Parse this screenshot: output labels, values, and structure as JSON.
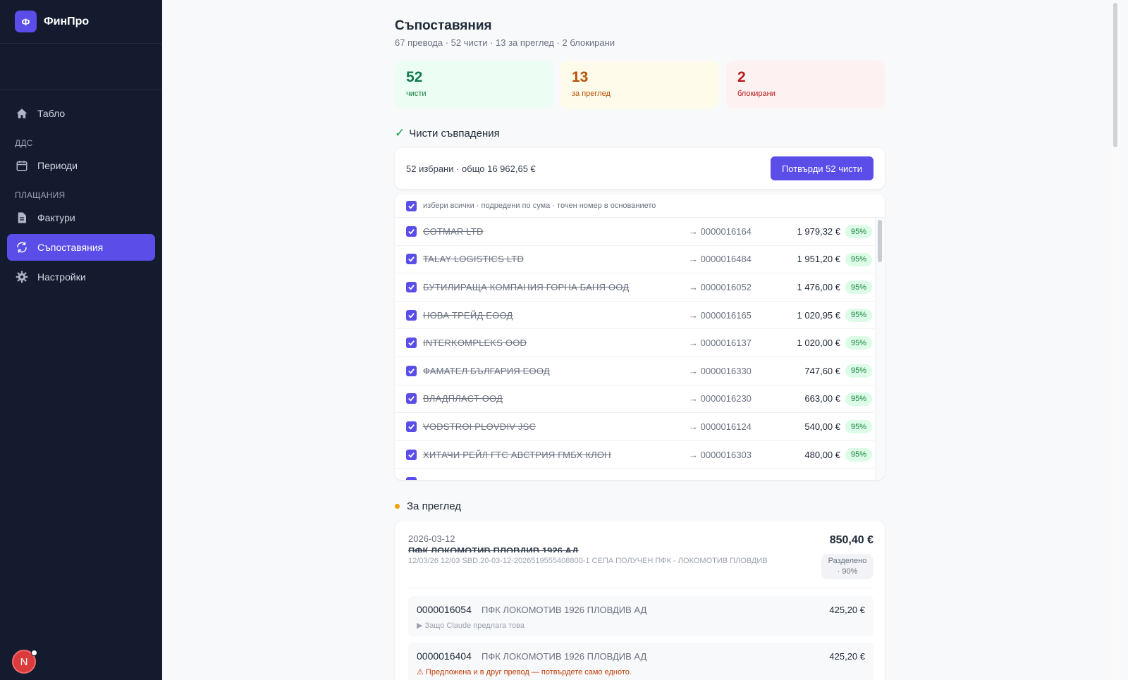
{
  "sidebar": {
    "brand_initial": "Ф",
    "brand_name": "ФинПро",
    "items": {
      "dashboard": "Табло",
      "section_vat": "ДДС",
      "periods": "Периоди",
      "section_payments": "ПЛАЩАНИЯ",
      "invoices": "Фактури",
      "matches": "Съпоставяния",
      "settings": "Настройки"
    },
    "avatar_initial": "N"
  },
  "header": {
    "title": "Съпоставяния",
    "subtitle": "67 превода · 52 чисти · 13 за преглед · 2 блокирани"
  },
  "stats": [
    {
      "value": "52",
      "label": "чисти"
    },
    {
      "value": "13",
      "label": "за преглед"
    },
    {
      "value": "2",
      "label": "блокирани"
    }
  ],
  "clean": {
    "heading": "Чисти съвпадения",
    "selected_text": "52 избрани · общо 16 962,65 €",
    "confirm_label": "Потвърди 52 чисти",
    "list_header": "избери всички · подредени по сума · точен номер в основанието",
    "rows": [
      {
        "name": "COTMAR LTD",
        "ref": "→ 0000016164",
        "amount": "1 979,32 €",
        "score": "95%"
      },
      {
        "name": "TALAY LOGISTICS LTD",
        "ref": "→ 0000016484",
        "amount": "1 951,20 €",
        "score": "95%"
      },
      {
        "name": "БУТИЛИРАЩА КОМПАНИЯ ГОРНА БАНЯ ООД",
        "ref": "→ 0000016052",
        "amount": "1 476,00 €",
        "score": "95%"
      },
      {
        "name": "НОВА ТРЕЙД ЕООД",
        "ref": "→ 0000016165",
        "amount": "1 020,95 €",
        "score": "95%"
      },
      {
        "name": "INTERKOMPLEKS OOD",
        "ref": "→ 0000016137",
        "amount": "1 020,00 €",
        "score": "95%"
      },
      {
        "name": "ФАМАТЕЛ БЪЛГАРИЯ ЕООД",
        "ref": "→ 0000016330",
        "amount": "747,60 €",
        "score": "95%"
      },
      {
        "name": "ВЛАДПЛАСТ ООД",
        "ref": "→ 0000016230",
        "amount": "663,00 €",
        "score": "95%"
      },
      {
        "name": "VODSTROI PLOVDIV JSC",
        "ref": "→ 0000016124",
        "amount": "540,00 €",
        "score": "95%"
      },
      {
        "name": "ХИТАЧИ РЕЙЛ ГТС АВСТРИЯ ГМБХ КЛОН",
        "ref": "→ 0000016303",
        "amount": "480,00 €",
        "score": "95%"
      }
    ]
  },
  "review": {
    "heading": "За преглед",
    "date": "2026-03-12",
    "party": "ПФК ЛОКОМОТИВ ПЛОВДИВ 1926 АД",
    "description": "12/03/26 12/03 SBD.20-03-12-2026519555408800-1 СЕПА ПОЛУЧЕН ПФК - ЛОКОМОТИВ ПЛОВДИВ",
    "total": "850,40 €",
    "split_line1": "Разделено",
    "split_line2": "· 90%",
    "invoices": [
      {
        "number": "0000016054",
        "party": "ПФК ЛОКОМОТИВ 1926 ПЛОВДИВ АД",
        "amount": "425,20 €",
        "note": "▶ Защо Claude предлага това"
      },
      {
        "number": "0000016404",
        "party": "ПФК ЛОКОМОТИВ 1926 ПЛОВДИВ АД",
        "amount": "425,20 €",
        "warning": "⚠ Предложена и в друг превод — потвърдете само едното."
      }
    ]
  },
  "colors": {
    "sidebar_bg": "#141b2e",
    "accent": "#5b4de8",
    "clean": "#0f7a4d",
    "review": "#b45309",
    "blocked": "#b91c1c"
  }
}
